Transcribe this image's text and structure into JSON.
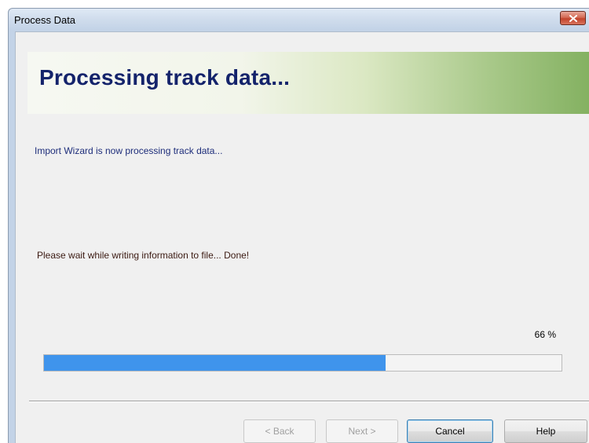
{
  "window": {
    "title": "Process Data"
  },
  "header": {
    "title": "Processing track data..."
  },
  "body": {
    "intro": "Import Wizard is now processing track data...",
    "status": "Please wait while writing information to file... Done!",
    "percent_label": "66 %",
    "progress_fraction": 0.66
  },
  "buttons": {
    "back": "< Back",
    "next": "Next >",
    "cancel": "Cancel",
    "help": "Help"
  },
  "colors": {
    "progress_fill": "#3f94ec",
    "header_title": "#14236b",
    "close_button": "#c2442c"
  },
  "icons": {
    "close": "close-icon"
  }
}
